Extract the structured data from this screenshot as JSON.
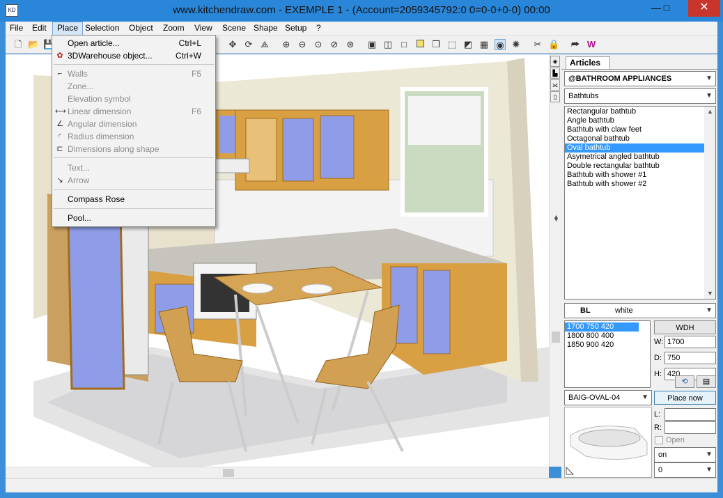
{
  "window": {
    "title": "www.kitchendraw.com - EXEMPLE 1 - (Account=2059345792:0 0=0-0+0-0) 00:00",
    "app_icon": "KD",
    "minimize_glyph": "—",
    "maximize_glyph": "□",
    "close_glyph": "✕"
  },
  "menubar": {
    "items": [
      "File",
      "Edit",
      "Place",
      "Selection",
      "Object",
      "Zoom",
      "View",
      "Scene",
      "Shape",
      "Setup",
      "?"
    ],
    "active": "Place"
  },
  "toolbar": {
    "icons": [
      "new-file-icon",
      "open-folder-icon",
      "save-icon",
      "move-icon",
      "rotate-icon",
      "mirror-icon",
      "zoom-in-icon",
      "zoom-out-icon",
      "zoom-window-icon",
      "zoom-previous-icon",
      "zoom-all-icon",
      "render-icon",
      "wireframe-icon",
      "hidden-line-icon",
      "color-icon",
      "box-icon",
      "cube-icon",
      "solid-icon",
      "texture-icon",
      "camera-icon",
      "light-icon",
      "tools-icon",
      "lock-icon",
      "export-icon",
      "web-icon"
    ]
  },
  "place_menu": {
    "items": [
      {
        "label": "Open article...",
        "shortcut": "Ctrl+L",
        "disabled": false,
        "icon": ""
      },
      {
        "label": "3DWarehouse object...",
        "shortcut": "Ctrl+W",
        "disabled": false,
        "icon": "warehouse-icon"
      },
      {
        "label": "Walls",
        "shortcut": "F5",
        "disabled": true,
        "icon": "walls-icon"
      },
      {
        "label": "Zone...",
        "shortcut": "",
        "disabled": true,
        "icon": ""
      },
      {
        "label": "Elevation symbol",
        "shortcut": "",
        "disabled": true,
        "icon": ""
      },
      {
        "label": "Linear dimension",
        "shortcut": "F6",
        "disabled": true,
        "icon": "linear-dimension-icon"
      },
      {
        "label": "Angular dimension",
        "shortcut": "",
        "disabled": true,
        "icon": "angular-dimension-icon"
      },
      {
        "label": "Radius dimension",
        "shortcut": "",
        "disabled": true,
        "icon": "radius-dimension-icon"
      },
      {
        "label": "Dimensions along shape",
        "shortcut": "",
        "disabled": true,
        "icon": "shape-dimension-icon"
      },
      {
        "label": "Text...",
        "shortcut": "",
        "disabled": true,
        "icon": ""
      },
      {
        "label": "Arrow",
        "shortcut": "",
        "disabled": true,
        "icon": "arrow-icon"
      },
      {
        "label": "Compass Rose",
        "shortcut": "",
        "disabled": false,
        "icon": ""
      },
      {
        "label": "Pool...",
        "shortcut": "",
        "disabled": false,
        "icon": ""
      }
    ]
  },
  "panel": {
    "tab": "Articles",
    "catalog": "@BATHROOM APPLIANCES",
    "category": "Bathtubs",
    "articles": [
      "Rectangular bathtub",
      "Angle bathtub",
      "Bathtub with claw feet",
      "Octagonal bathtub",
      "Oval bathtub",
      "Asymetrical angled bathtub",
      "Double rectangular bathtub",
      "Bathtub with shower #1",
      "Bathtub with shower #2"
    ],
    "selected_article": "Oval bathtub",
    "finish_code": "BL",
    "finish_name": "white",
    "sizes": [
      "1700  750  420",
      "1800  800  400",
      "1850  900  420"
    ],
    "selected_size": "1700  750  420",
    "wdh_button": "WDH",
    "w_label": "W:",
    "w_value": "1700",
    "d_label": "D:",
    "d_value": "750",
    "h_label": "H:",
    "h_value": "420",
    "reference": "BAIG-OVAL-04",
    "place_now_button": "Place now",
    "l_label": "L:",
    "r_label": "R:",
    "open_label": "Open",
    "on_select": "on",
    "zero_select": "0"
  },
  "colors": {
    "title_bar": "#2a86d8",
    "close": "#c8352c",
    "selection": "#3399ff",
    "cabinet_wood": "#d9a043",
    "cabinet_panel": "#8f9ce8"
  }
}
